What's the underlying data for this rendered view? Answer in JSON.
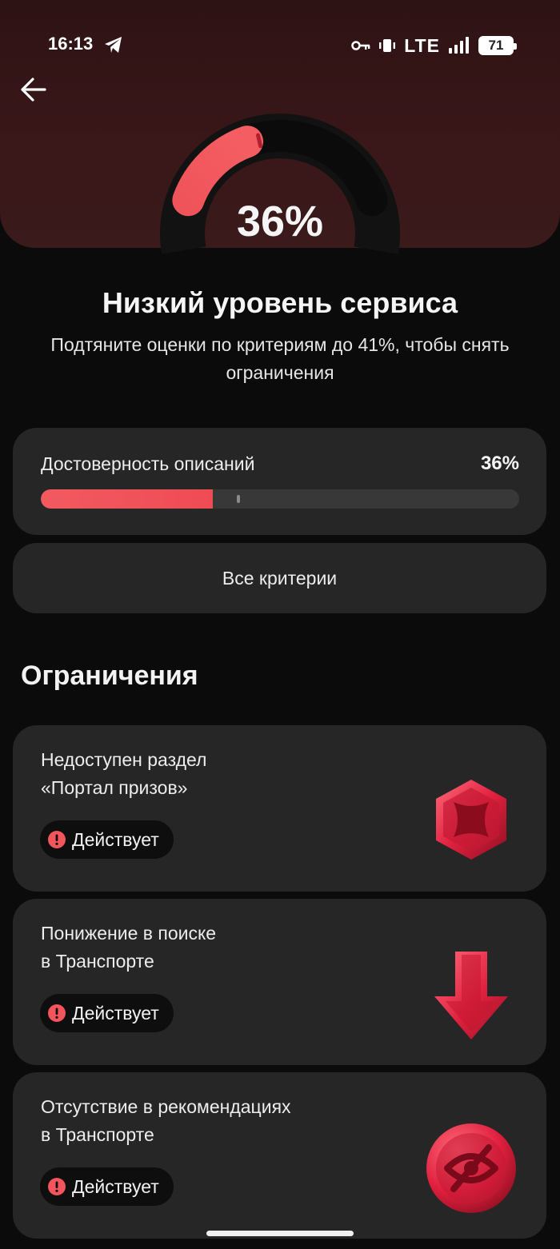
{
  "status_bar": {
    "time": "16:13",
    "network": "LTE",
    "battery": "71"
  },
  "gauge": {
    "percent_label": "36%",
    "value_fraction": 0.36,
    "target_fraction": 0.41
  },
  "summary": {
    "title": "Низкий уровень сервиса",
    "subtitle": "Подтяните оценки по критериям до 41%, чтобы снять ограничения"
  },
  "criterion": {
    "name": "Достоверность описаний",
    "value_label": "36%",
    "value_fraction": 0.36,
    "target_fraction": 0.41
  },
  "all_criteria_label": "Все критерии",
  "restrictions_title": "Ограничения",
  "restrictions": [
    {
      "line1": "Недоступен раздел",
      "line2": "«Портал призов»",
      "status": "Действует",
      "icon": "prize-portal-hexagon-icon"
    },
    {
      "line1": "Понижение в поиске",
      "line2": "в Транспорте",
      "status": "Действует",
      "icon": "arrow-down-icon"
    },
    {
      "line1": "Отсутствие в рекомендациях",
      "line2": "в Транспорте",
      "status": "Действует",
      "icon": "eye-off-icon"
    }
  ],
  "colors": {
    "accent": "#f2555c",
    "card": "#262626",
    "background": "#0b0b0b"
  }
}
